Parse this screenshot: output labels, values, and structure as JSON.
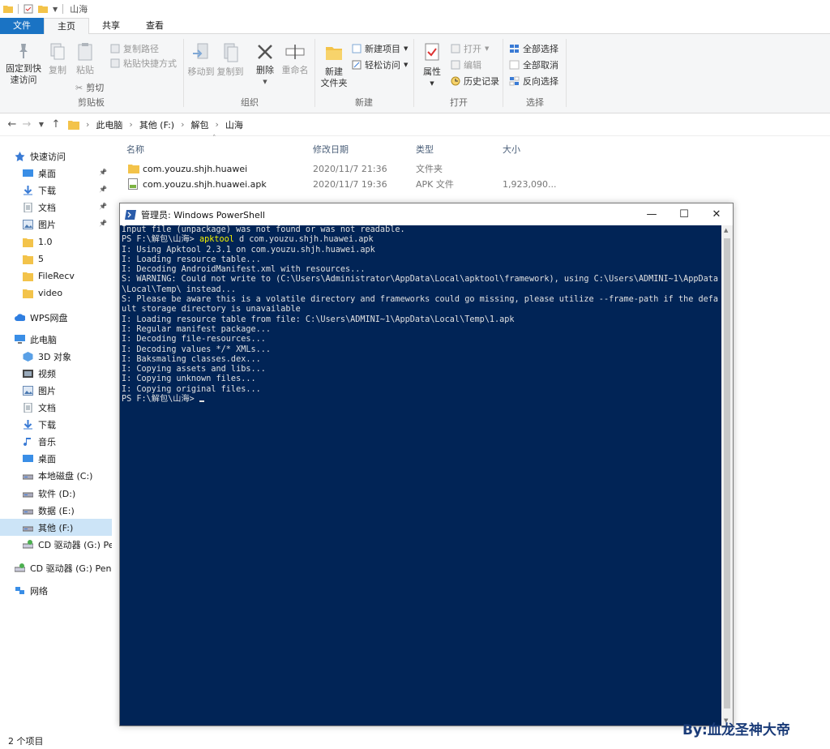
{
  "window": {
    "title": "山海"
  },
  "ribbon_tabs": [
    {
      "label": "文件"
    },
    {
      "label": "主页"
    },
    {
      "label": "共享"
    },
    {
      "label": "查看"
    }
  ],
  "ribbon": {
    "clipboard": {
      "pin_quick": "固定到快\n速访问",
      "copy": "复制",
      "paste": "粘贴",
      "copy_path": "复制路径",
      "paste_shortcut": "粘贴快捷方式",
      "cut": "剪切",
      "label": "剪贴板"
    },
    "organize": {
      "move_to": "移动到",
      "copy_to": "复制到",
      "delete": "删除",
      "rename": "重命名",
      "label": "组织"
    },
    "new": {
      "new_folder": "新建\n文件夹",
      "new_item": "新建项目",
      "easy_access": "轻松访问",
      "label": "新建"
    },
    "open": {
      "properties": "属性",
      "open": "打开",
      "edit": "编辑",
      "history": "历史记录",
      "label": "打开"
    },
    "select": {
      "select_all": "全部选择",
      "select_none": "全部取消",
      "invert": "反向选择",
      "label": "选择"
    }
  },
  "address": {
    "crumbs": [
      "此电脑",
      "其他 (F:)",
      "解包",
      "山海"
    ]
  },
  "sidebar": {
    "items": [
      {
        "label": "快速访问",
        "pinned": false
      },
      {
        "label": "桌面",
        "pinned": true
      },
      {
        "label": "下载",
        "pinned": true
      },
      {
        "label": "文档",
        "pinned": true
      },
      {
        "label": "图片",
        "pinned": true
      },
      {
        "label": "1.0",
        "pinned": false
      },
      {
        "label": "5",
        "pinned": false
      },
      {
        "label": "FileRecv",
        "pinned": false
      },
      {
        "label": "video",
        "pinned": false
      },
      {
        "label": "WPS网盘",
        "pinned": false
      },
      {
        "label": "此电脑",
        "pinned": false
      },
      {
        "label": "3D 对象",
        "pinned": false
      },
      {
        "label": "视频",
        "pinned": false
      },
      {
        "label": "图片",
        "pinned": false
      },
      {
        "label": "文档",
        "pinned": false
      },
      {
        "label": "下载",
        "pinned": false
      },
      {
        "label": "音乐",
        "pinned": false
      },
      {
        "label": "桌面",
        "pinned": false
      },
      {
        "label": "本地磁盘 (C:)",
        "pinned": false
      },
      {
        "label": "软件 (D:)",
        "pinned": false
      },
      {
        "label": "数据 (E:)",
        "pinned": false
      },
      {
        "label": "其他 (F:)",
        "pinned": false
      },
      {
        "label": "CD 驱动器 (G:) Pen",
        "pinned": false
      },
      {
        "label": "CD 驱动器 (G:) Pen",
        "pinned": false
      },
      {
        "label": "网络",
        "pinned": false
      }
    ]
  },
  "file_list": {
    "headers": {
      "name": "名称",
      "modified": "修改日期",
      "type": "类型",
      "size": "大小"
    },
    "rows": [
      {
        "name": "com.youzu.shjh.huawei",
        "modified": "2020/11/7 21:36",
        "type": "文件夹",
        "size": ""
      },
      {
        "name": "com.youzu.shjh.huawei.apk",
        "modified": "2020/11/7 19:36",
        "type": "APK 文件",
        "size": "1,923,090..."
      }
    ]
  },
  "powershell": {
    "title": "管理员: Windows PowerShell",
    "lines": [
      "Input file (unpackage) was not found or was not readable.",
      "I: Using Apktool 2.3.1 on com.youzu.shjh.huawei.apk",
      "I: Loading resource table...",
      "I: Decoding AndroidManifest.xml with resources...",
      "S: WARNING: Could not write to (C:\\Users\\Administrator\\AppData\\Local\\apktool\\framework), using C:\\Users\\ADMINI~1\\AppData",
      "\\Local\\Temp\\ instead...",
      "S: Please be aware this is a volatile directory and frameworks could go missing, please utilize --frame-path if the defa",
      "ult storage directory is unavailable",
      "I: Loading resource table from file: C:\\Users\\ADMINI~1\\AppData\\Local\\Temp\\1.apk",
      "I: Regular manifest package...",
      "I: Decoding file-resources...",
      "I: Decoding values */* XMLs...",
      "I: Baksmaling classes.dex...",
      "I: Copying assets and libs...",
      "I: Copying unknown files...",
      "I: Copying original files..."
    ],
    "prompt1": "PS F:\\解包\\山海> ",
    "cmd_name": "apktool",
    "cmd_args": " d com.youzu.shjh.huawei.apk",
    "prompt2": "PS F:\\解包\\山海> "
  },
  "status": {
    "items": "2 个项目"
  },
  "watermark": "By:血龙圣神大帝",
  "colors": {
    "accent": "#1a73c4",
    "ps_bg": "#012456",
    "ps_cmd": "#f5f200",
    "selected": "#cce4f7"
  }
}
